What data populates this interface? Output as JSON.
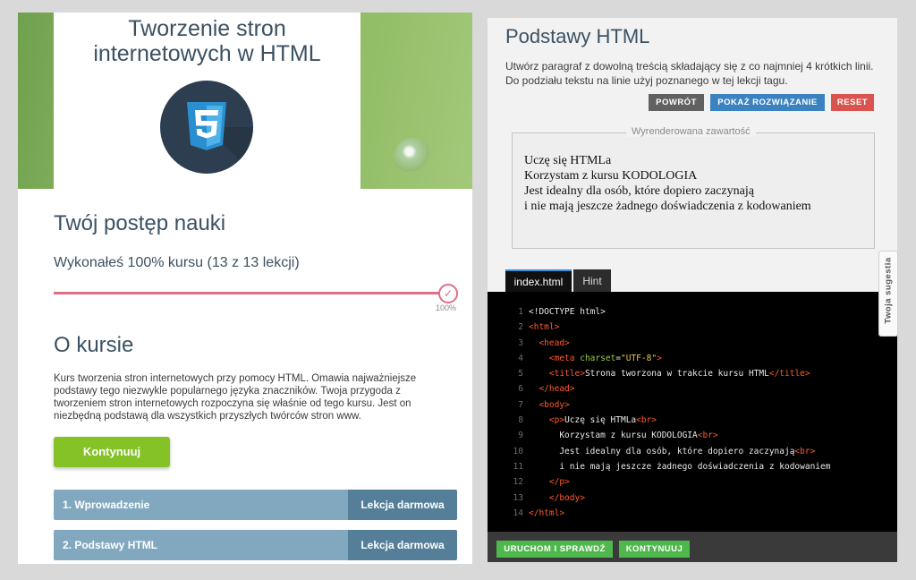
{
  "left": {
    "course_title_line1": "Tworzenie stron",
    "course_title_line2": "internetowych w HTML",
    "logo_icon": "html5-logo-icon",
    "progress_heading": "Twój postęp nauki",
    "progress_text": "Wykonałeś 100% kursu (13 z 13 lekcji)",
    "progress_value": 1.0,
    "progress_percent_label": "100%",
    "about_heading": "O kursie",
    "about_text": "Kurs tworzenia stron internetowych przy pomocy HTML. Omawia najważniejsze podstawy tego niezwykle popularnego języka znaczników. Twoja przygoda z tworzeniem stron internetowych rozpoczyna się właśnie od tego kursu. Jest on niezbędną podstawą dla wszystkich przyszłych twórców stron www.",
    "continue_button": "Kontynuuj",
    "lessons": [
      {
        "name": "1. Wprowadzenie",
        "tag": "Lekcja darmowa"
      },
      {
        "name": "2. Podstawy HTML",
        "tag": "Lekcja darmowa"
      }
    ]
  },
  "right": {
    "title": "Podstawy HTML",
    "description": "Utwórz paragraf z dowolną treścią składający się z co najmniej 4 krótkich linii. Do podziału tekstu na linie użyj poznanego w tej lekcji tagu.",
    "buttons": {
      "back": "POWRÓT",
      "solution": "POKAŻ ROZWIĄZANIE",
      "reset": "RESET"
    },
    "rendered_label": "Wyrenderowana zawartość",
    "rendered_lines": [
      "Uczę się HTMLa",
      "Korzystam z kursu KODOLOGIA",
      "Jest idealny dla osób, które dopiero zaczynają",
      "i nie mają jeszcze żadnego doświadczenia z kodowaniem"
    ],
    "tabs": [
      "index.html",
      "Hint"
    ],
    "code_lines": [
      "<!DOCTYPE html>",
      "<html>",
      "  <head>",
      "    <meta charset=\"UTF-8\">",
      "    <title>Strona tworzona w trakcie kursu HTML</title>",
      "  </head>",
      "  <body>",
      "    <p>Uczę się HTMLa<br>",
      "      Korzystam z kursu KODOLOGIA<br>",
      "      Jest idealny dla osób, które dopiero zaczynają<br>",
      "      i nie mają jeszcze żadnego doświadczenia z kodowaniem",
      "    </p>",
      "    </body>",
      "</html>"
    ],
    "footer_buttons": {
      "run": "URUCHOM I SPRAWDŹ",
      "continue": "KONTYNUUJ"
    },
    "suggestion_tab": "Twoja sugestia"
  },
  "colors": {
    "progress_accent": "#e06e86",
    "continue_green": "#84c225",
    "lesson_bar": "#82a8c0",
    "lesson_tag": "#557f99",
    "btn_back": "#616161",
    "btn_solution": "#3b83c0",
    "btn_reset": "#d9534f",
    "run_green": "#4fb84d"
  }
}
